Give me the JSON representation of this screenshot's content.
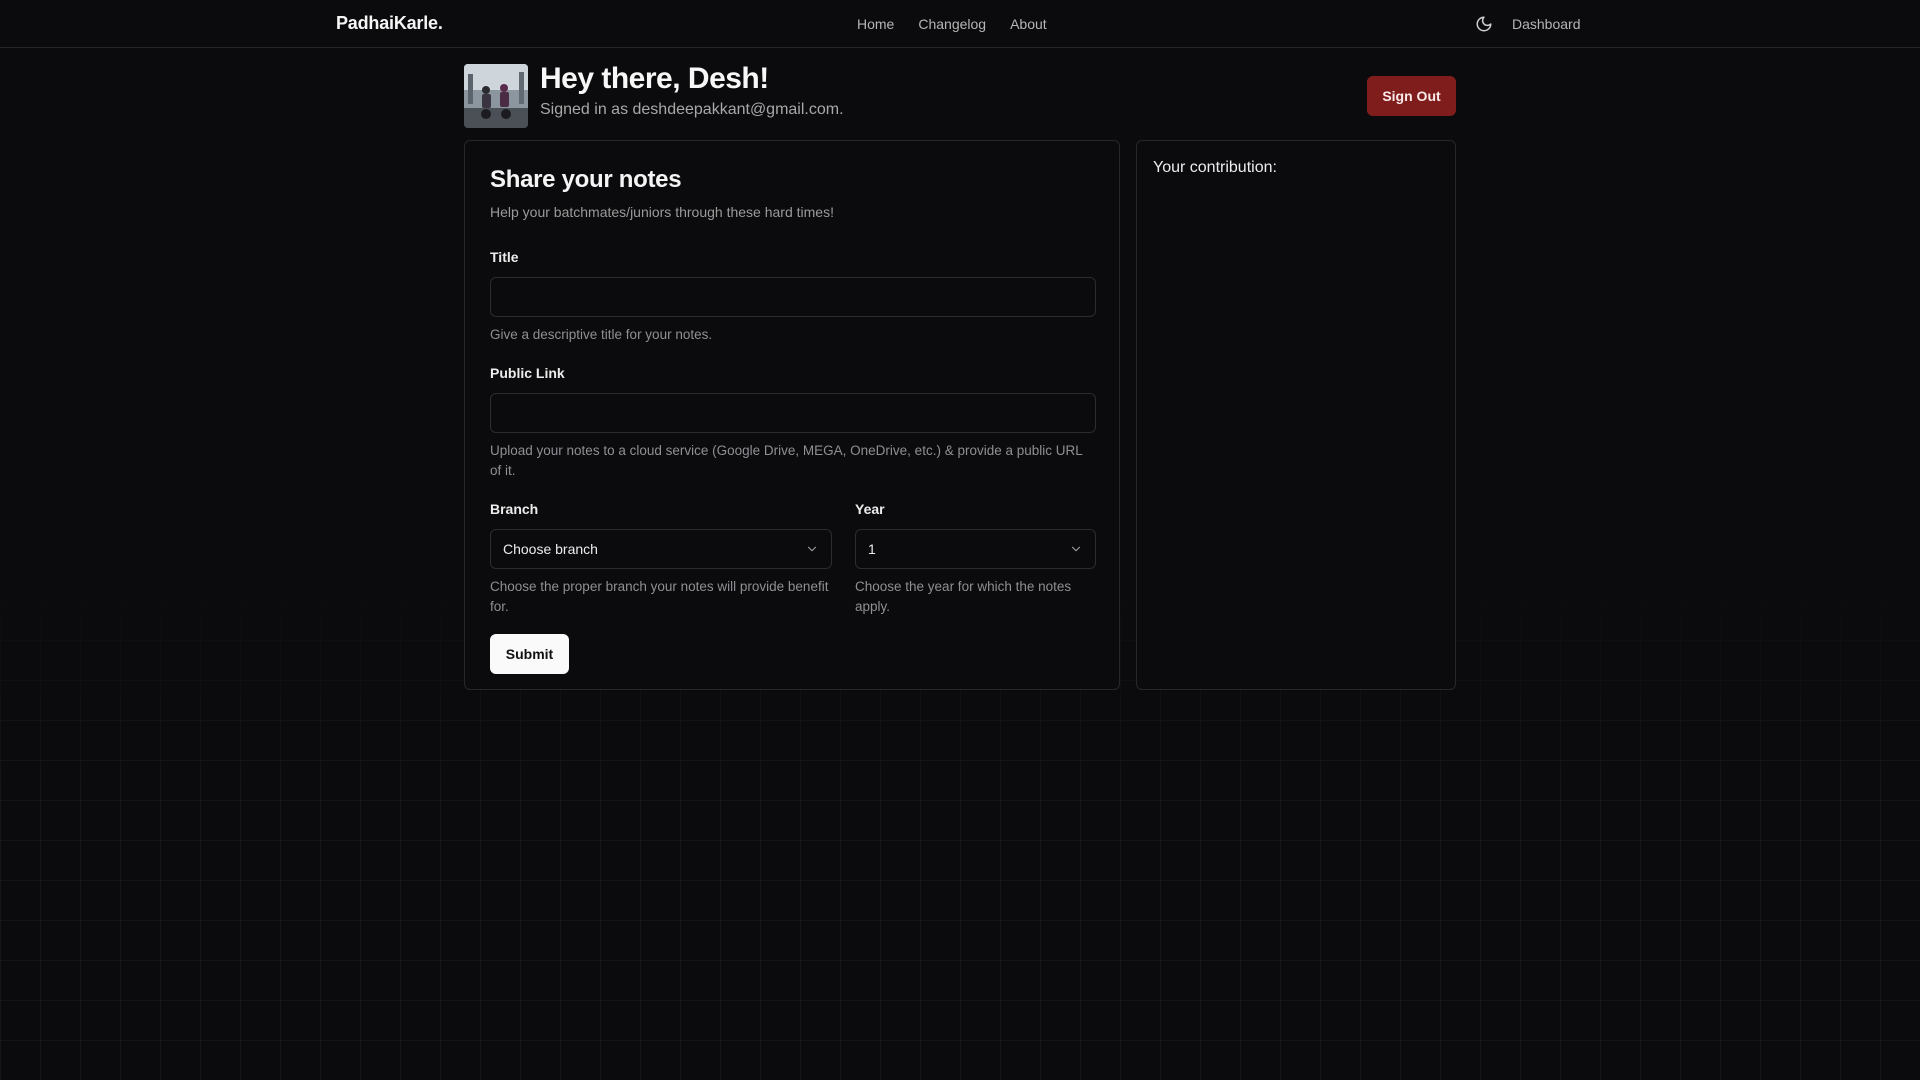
{
  "header": {
    "brand": "PadhaiKarle.",
    "nav": [
      "Home",
      "Changelog",
      "About"
    ],
    "theme_icon": "moon-icon",
    "dashboard_label": "Dashboard"
  },
  "profile": {
    "greeting": "Hey there, Desh!",
    "signed_in_text": "Signed in as deshdeepakkant@gmail.com.",
    "signout_label": "Sign Out",
    "signout_color": "#7f1d1d"
  },
  "form": {
    "title": "Share your notes",
    "subtitle": "Help your batchmates/juniors through these hard times!",
    "title_field": {
      "label": "Title",
      "value": "",
      "help": "Give a descriptive title for your notes."
    },
    "link_field": {
      "label": "Public Link",
      "value": "",
      "help": "Upload your notes to a cloud service (Google Drive, MEGA, OneDrive, etc.) & provide a public URL of it."
    },
    "branch_field": {
      "label": "Branch",
      "selected": "Choose branch",
      "help": "Choose the proper branch your notes will provide benefit for."
    },
    "year_field": {
      "label": "Year",
      "selected": "1",
      "help": "Choose the year for which the notes apply."
    },
    "submit_label": "Submit"
  },
  "contribution": {
    "title": "Your contribution:"
  }
}
